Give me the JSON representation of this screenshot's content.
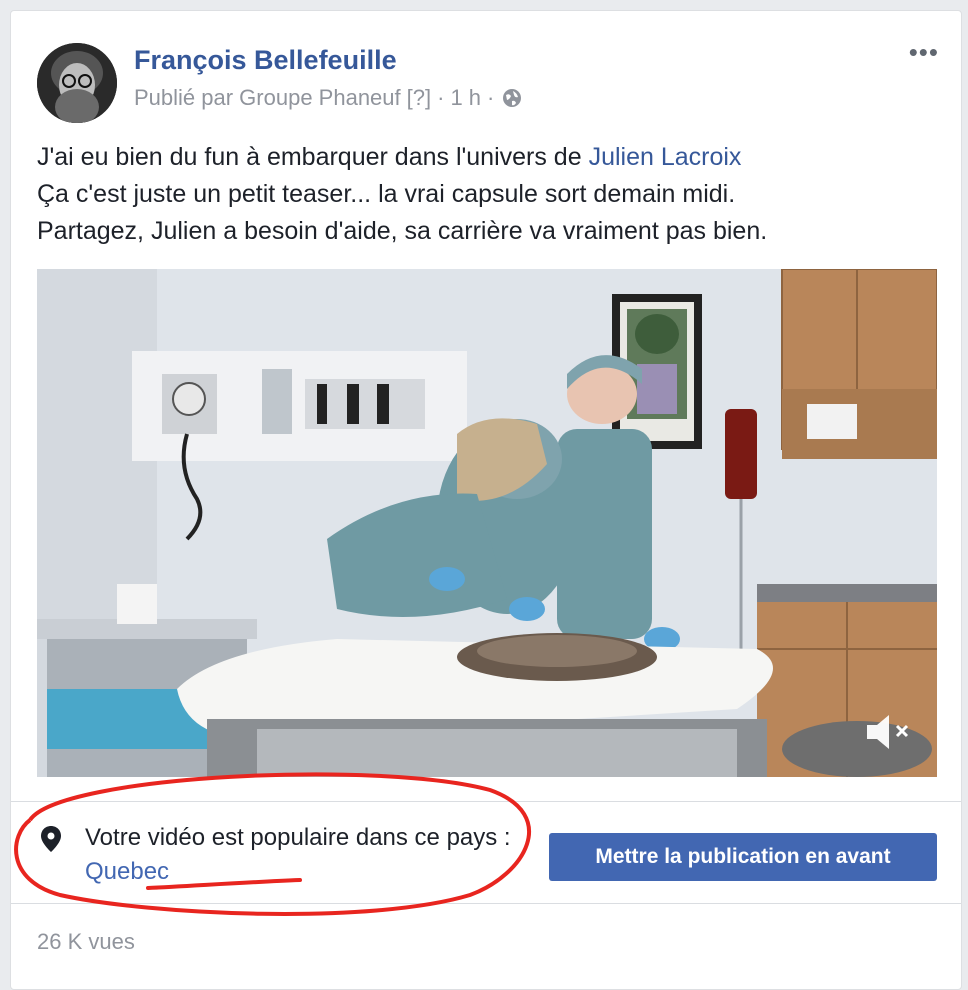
{
  "post": {
    "author": "François Bellefeuille",
    "published_by": "Publié par Groupe Phaneuf",
    "help_marker": "[?]",
    "separator": "·",
    "time": "1 h",
    "text_line1_prefix": "J'ai eu bien du fun à embarquer dans l'univers de ",
    "text_line1_mention": "Julien Lacroix",
    "text_line2": "Ça c'est juste un petit teaser... la vrai capsule sort demain midi.",
    "text_line3": "Partagez, Julien a besoin d'aide, sa carrière va vraiment pas bien."
  },
  "insight": {
    "message": "Votre vidéo est populaire dans ce pays : ",
    "country": "Quebec",
    "boost_label": "Mettre la publication en avant"
  },
  "footer": {
    "views": "26 K vues"
  },
  "colors": {
    "link": "#365899",
    "button": "#4267b2",
    "annotation": "#e8251f"
  },
  "icons": [
    "globe-icon",
    "more-icon",
    "mute-icon",
    "location-pin-icon"
  ]
}
